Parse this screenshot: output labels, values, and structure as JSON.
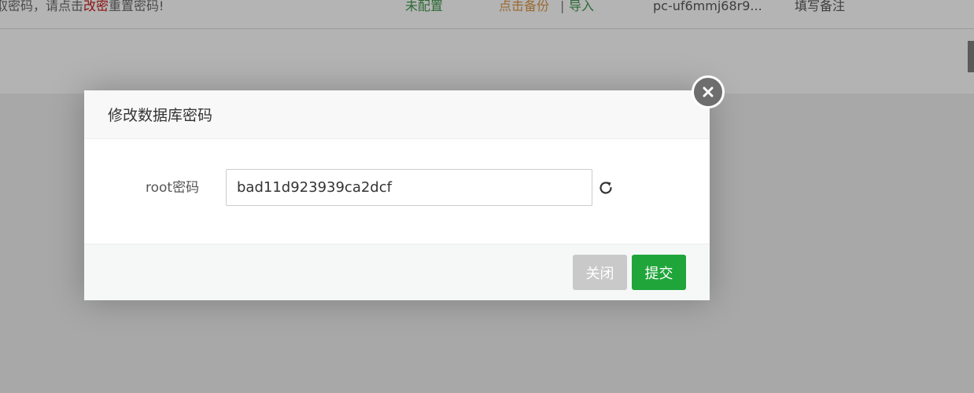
{
  "background": {
    "notice_prefix": "获取密码，请点击",
    "notice_link": "改密",
    "notice_suffix": "重置密码!",
    "status": "未配置",
    "backup_link": "点击备份",
    "separator": "|",
    "import_link": "导入",
    "instance_id": "pc-uf6mmj68r9...",
    "remark_placeholder": "填写备注"
  },
  "dialog": {
    "title": "修改数据库密码",
    "field_label": "root密码",
    "password_value": "bad11d923939ca2dcf",
    "close_button": "关闭",
    "submit_button": "提交"
  },
  "icons": {
    "refresh": "refresh-icon",
    "close": "close-icon"
  },
  "colors": {
    "submit": "#20a53a",
    "close_button": "#c9c9c9",
    "link_red": "#b00000",
    "status_green": "#1f7a2e",
    "backup_orange": "#b8742a"
  }
}
